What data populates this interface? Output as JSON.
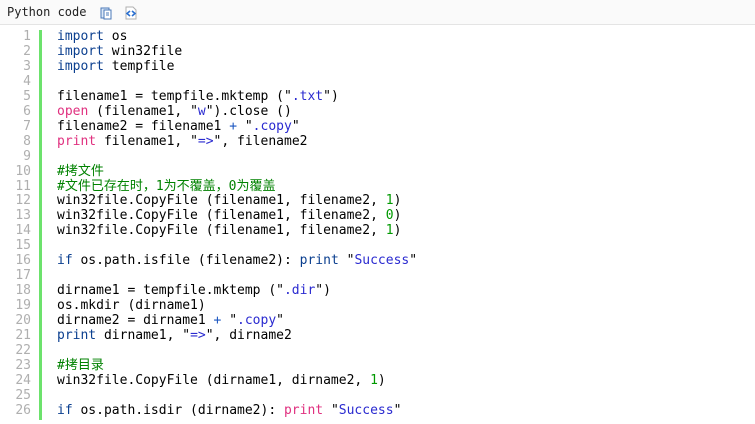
{
  "header": {
    "title": "Python code",
    "icons": [
      "copy-icon",
      "view-source-icon"
    ]
  },
  "lines": [
    {
      "n": "1",
      "t": [
        [
          "kw",
          "import"
        ],
        [
          "p",
          " os"
        ]
      ]
    },
    {
      "n": "2",
      "t": [
        [
          "kw",
          "import"
        ],
        [
          "p",
          " win32file"
        ]
      ]
    },
    {
      "n": "3",
      "t": [
        [
          "kw",
          "import"
        ],
        [
          "p",
          " tempfile"
        ]
      ]
    },
    {
      "n": "4",
      "t": []
    },
    {
      "n": "5",
      "t": [
        [
          "p",
          "filename1 = tempfile.mktemp ("
        ],
        [
          "q",
          "\""
        ],
        [
          "str",
          ".txt"
        ],
        [
          "q",
          "\""
        ],
        [
          "p",
          ")"
        ]
      ]
    },
    {
      "n": "6",
      "t": [
        [
          "fn",
          "open"
        ],
        [
          "p",
          " (filename1, "
        ],
        [
          "q",
          "\""
        ],
        [
          "str",
          "w"
        ],
        [
          "q",
          "\""
        ],
        [
          "p",
          ").close ()"
        ]
      ]
    },
    {
      "n": "7",
      "t": [
        [
          "p",
          "filename2 = filename1 "
        ],
        [
          "op",
          "+"
        ],
        [
          "p",
          " "
        ],
        [
          "q",
          "\""
        ],
        [
          "str",
          ".copy"
        ],
        [
          "q",
          "\""
        ]
      ]
    },
    {
      "n": "8",
      "t": [
        [
          "fn",
          "print"
        ],
        [
          "p",
          " filename1, "
        ],
        [
          "q",
          "\""
        ],
        [
          "str",
          "=>"
        ],
        [
          "q",
          "\""
        ],
        [
          "p",
          ", filename2"
        ]
      ]
    },
    {
      "n": "9",
      "t": []
    },
    {
      "n": "10",
      "t": [
        [
          "cm",
          "#拷文件"
        ]
      ]
    },
    {
      "n": "11",
      "t": [
        [
          "cm",
          "#文件已存在时，1为不覆盖，0为覆盖"
        ]
      ]
    },
    {
      "n": "12",
      "t": [
        [
          "p",
          "win32file.CopyFile (filename1, filename2, "
        ],
        [
          "num",
          "1"
        ],
        [
          "p",
          ")"
        ]
      ]
    },
    {
      "n": "13",
      "t": [
        [
          "p",
          "win32file.CopyFile (filename1, filename2, "
        ],
        [
          "num",
          "0"
        ],
        [
          "p",
          ")"
        ]
      ]
    },
    {
      "n": "14",
      "t": [
        [
          "p",
          "win32file.CopyFile (filename1, filename2, "
        ],
        [
          "num",
          "1"
        ],
        [
          "p",
          ")"
        ]
      ]
    },
    {
      "n": "15",
      "t": []
    },
    {
      "n": "16",
      "t": [
        [
          "kw",
          "if"
        ],
        [
          "p",
          " os.path.isfile (filename2): "
        ],
        [
          "pb",
          "print"
        ],
        [
          "p",
          " "
        ],
        [
          "q",
          "\""
        ],
        [
          "str",
          "Success"
        ],
        [
          "q",
          "\""
        ]
      ]
    },
    {
      "n": "17",
      "t": []
    },
    {
      "n": "18",
      "t": [
        [
          "p",
          "dirname1 = tempfile.mktemp ("
        ],
        [
          "q",
          "\""
        ],
        [
          "str",
          ".dir"
        ],
        [
          "q",
          "\""
        ],
        [
          "p",
          ")"
        ]
      ]
    },
    {
      "n": "19",
      "t": [
        [
          "p",
          "os.mkdir (dirname1)"
        ]
      ]
    },
    {
      "n": "20",
      "t": [
        [
          "p",
          "dirname2 = dirname1 "
        ],
        [
          "op",
          "+"
        ],
        [
          "p",
          " "
        ],
        [
          "q",
          "\""
        ],
        [
          "str",
          ".copy"
        ],
        [
          "q",
          "\""
        ]
      ]
    },
    {
      "n": "21",
      "t": [
        [
          "pb",
          "print"
        ],
        [
          "p",
          " dirname1, "
        ],
        [
          "q",
          "\""
        ],
        [
          "str",
          "=>"
        ],
        [
          "q",
          "\""
        ],
        [
          "p",
          ", dirname2"
        ]
      ]
    },
    {
      "n": "22",
      "t": []
    },
    {
      "n": "23",
      "t": [
        [
          "cm",
          "#拷目录"
        ]
      ]
    },
    {
      "n": "24",
      "t": [
        [
          "p",
          "win32file.CopyFile (dirname1, dirname2, "
        ],
        [
          "num",
          "1"
        ],
        [
          "p",
          ")"
        ]
      ]
    },
    {
      "n": "25",
      "t": []
    },
    {
      "n": "26",
      "t": [
        [
          "kw",
          "if"
        ],
        [
          "p",
          " os.path.isdir (dirname2): "
        ],
        [
          "fn",
          "print"
        ],
        [
          "p",
          " "
        ],
        [
          "q",
          "\""
        ],
        [
          "str",
          "Success"
        ],
        [
          "q",
          "\""
        ]
      ]
    }
  ]
}
